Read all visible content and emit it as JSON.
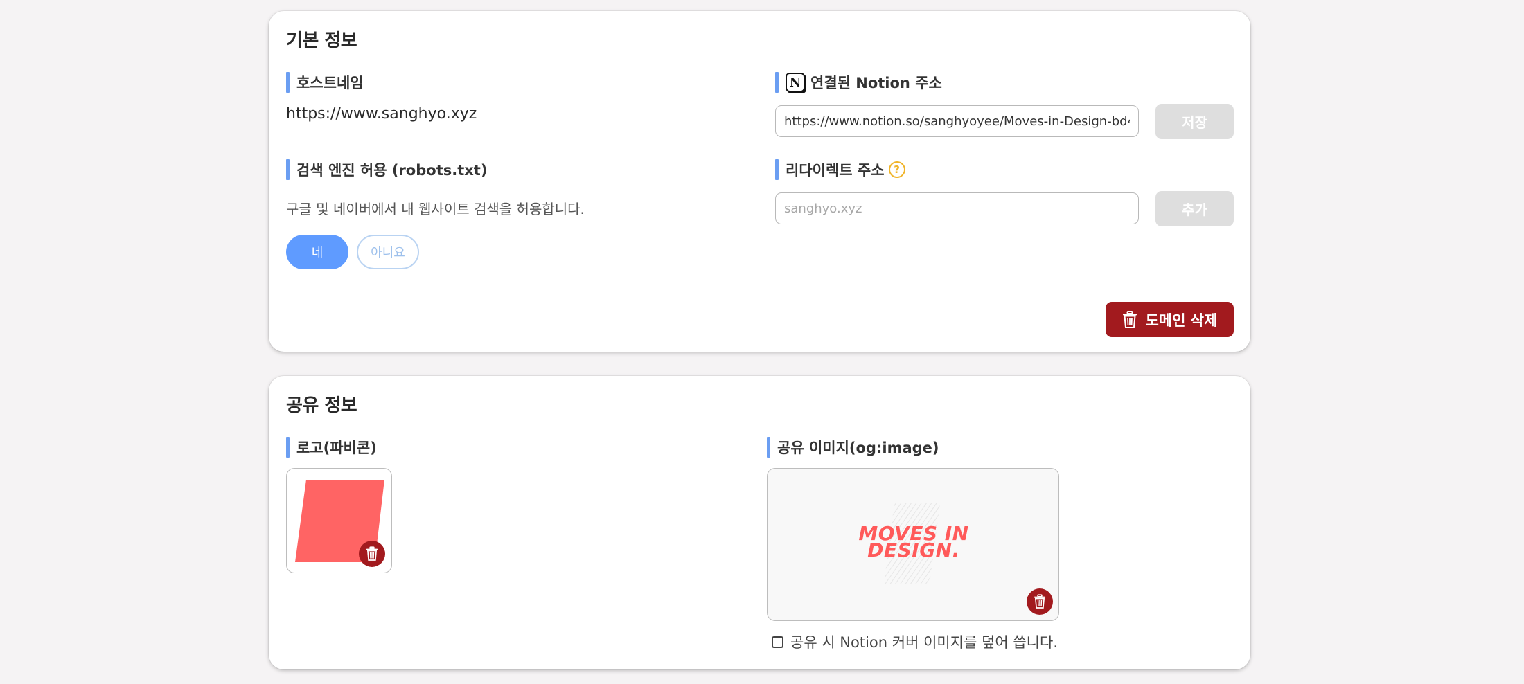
{
  "basic_info": {
    "title": "기본 정보",
    "hostname": {
      "label": "호스트네임",
      "value": "https://www.sanghyo.xyz"
    },
    "notion_url": {
      "label": "연결된 Notion 주소",
      "value": "https://www.notion.so/sanghyoyee/Moves-in-Design-bd4",
      "save_label": "저장"
    },
    "robots": {
      "label": "검색 엔진 허용 (robots.txt)",
      "description": "구글 및 네이버에서 내 웹사이트 검색을 허용합니다.",
      "yes_label": "네",
      "no_label": "아니요",
      "selected": "네"
    },
    "redirect": {
      "label": "리다이렉트 주소",
      "help_glyph": "?",
      "placeholder": "sanghyo.xyz",
      "add_label": "추가"
    },
    "delete_domain_label": "도메인 삭제"
  },
  "share_info": {
    "title": "공유 정보",
    "logo_label": "로고(파비콘)",
    "og_image_label": "공유 이미지(og:image)",
    "og_image_text_line1": "MOVES IN",
    "og_image_text_line2": "DESIGN.",
    "cover_checkbox_label": "공유 시 Notion 커버 이미지를 덮어 씁니다.",
    "cover_checked": false
  },
  "colors": {
    "accent_blue": "#5f9bff",
    "danger_red": "#a21a1e",
    "logo_red": "#ff6464",
    "help_yellow": "#f0b429"
  },
  "icons": [
    "notion-icon",
    "help-icon",
    "trash-icon"
  ]
}
